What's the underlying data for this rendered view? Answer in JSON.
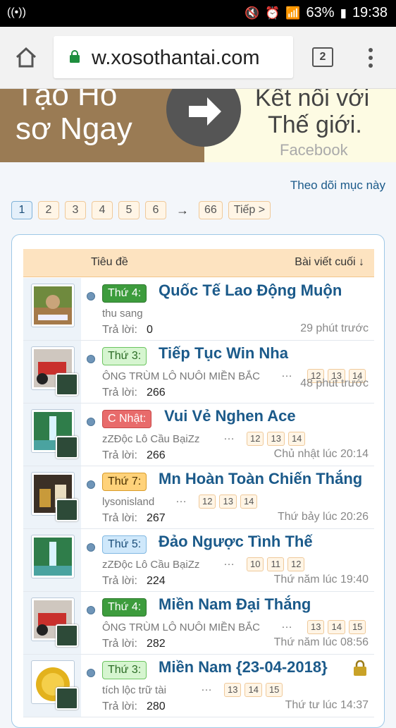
{
  "status": {
    "battery_pct": "63%",
    "time": "19:38"
  },
  "browser": {
    "url": "w.xosothantai.com",
    "tab_count": "2"
  },
  "banner": {
    "left_line1": "Tạo Hồ",
    "left_line2": "sơ Ngay",
    "right_line1": "Kết nối với",
    "right_line2": "Thế giới.",
    "right_line3": "Facebook"
  },
  "follow_link": "Theo dõi mục này",
  "pagination": {
    "pages": [
      "1",
      "2",
      "3",
      "4",
      "5",
      "6"
    ],
    "arrow": "→",
    "last": "66",
    "next": "Tiếp >"
  },
  "table_header": {
    "title_col": "Tiêu đề",
    "last_post_col": "Bài viết cuối ↓"
  },
  "replies_label": "Trả lời:",
  "threads": [
    {
      "tag": "Thứ 4:",
      "title": "Quốc Tế Lao Động Muộn",
      "author": "thu sang",
      "mini_pages": [],
      "replies": "0",
      "last_post": "29 phút trước"
    },
    {
      "tag": "Thứ 3:",
      "title": "Tiếp Tục Win Nha",
      "author": "ÔNG TRÙM LÔ NUÔI MIỀN BẮC",
      "mini_pages": [
        "12",
        "13",
        "14"
      ],
      "replies": "266",
      "last_post": "48 phút trước"
    },
    {
      "tag": "C Nhật:",
      "title": "Vui Vẻ Nghen Ace",
      "author": "zZĐộc Lô Cầu BạiZz",
      "mini_pages": [
        "12",
        "13",
        "14"
      ],
      "replies": "266",
      "last_post": "Chủ nhật lúc 20:14"
    },
    {
      "tag": "Thứ 7:",
      "title": "Mn Hoàn Toàn Chiến Thắng",
      "author": "lysonisland",
      "mini_pages": [
        "12",
        "13",
        "14"
      ],
      "replies": "267",
      "last_post": "Thứ bảy lúc 20:26"
    },
    {
      "tag": "Thứ 5:",
      "title": "Đảo Ngược Tình Thế",
      "author": "zZĐộc Lô Cầu BạiZz",
      "mini_pages": [
        "10",
        "11",
        "12"
      ],
      "replies": "224",
      "last_post": "Thứ năm lúc 19:40"
    },
    {
      "tag": "Thứ 4:",
      "title": "Miền Nam Đại Thắng",
      "author": "ÔNG TRÙM LÔ NUÔI MIỀN BẮC",
      "mini_pages": [
        "13",
        "14",
        "15"
      ],
      "replies": "282",
      "last_post": "Thứ năm lúc 08:56"
    },
    {
      "tag": "Thứ 3:",
      "title": "Miền Nam {23-04-2018}",
      "author": "tích lộc trữ tài",
      "mini_pages": [
        "13",
        "14",
        "15"
      ],
      "replies": "280",
      "last_post": "Thứ tư lúc 14:37"
    }
  ]
}
